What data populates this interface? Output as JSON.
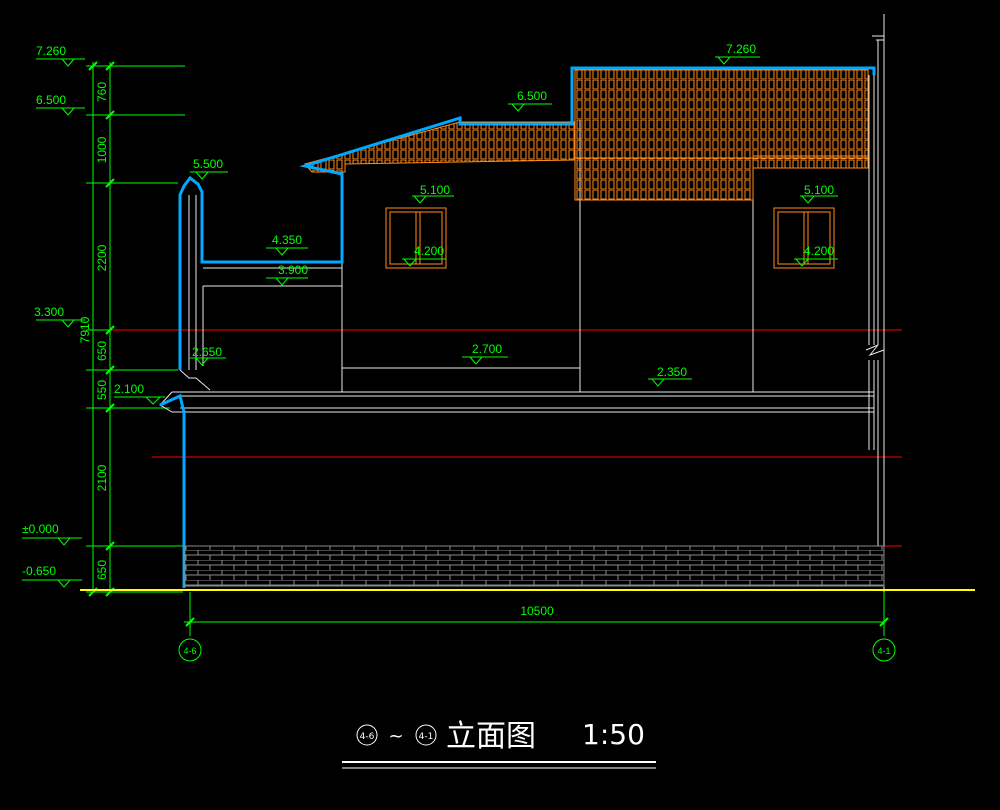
{
  "drawing": {
    "levels": [
      {
        "id": "left-7260",
        "text": "7.260"
      },
      {
        "id": "left-6500",
        "text": "6.500"
      },
      {
        "id": "left-3300",
        "text": "3.300"
      },
      {
        "id": "left-2100",
        "text": "2.100"
      },
      {
        "id": "left-0000",
        "text": "±0.000"
      },
      {
        "id": "left-m0650",
        "text": "-0.650"
      },
      {
        "id": "parapet-5500",
        "text": "5.500"
      },
      {
        "id": "low-roof-4350",
        "text": "4.350"
      },
      {
        "id": "low-roof-3900",
        "text": "3.900"
      },
      {
        "id": "canopy-2650",
        "text": "2.650"
      },
      {
        "id": "eave-6500",
        "text": "6.500"
      },
      {
        "id": "ridge-7260",
        "text": "7.260"
      },
      {
        "id": "win1-5100",
        "text": "5.100"
      },
      {
        "id": "win1-4200",
        "text": "4.200"
      },
      {
        "id": "win2-5100",
        "text": "5.100"
      },
      {
        "id": "win2-4200",
        "text": "4.200"
      },
      {
        "id": "floor-2700",
        "text": "2.700"
      },
      {
        "id": "floor-2350",
        "text": "2.350"
      }
    ],
    "vertical_dims": [
      "760",
      "1000",
      "2200",
      "650",
      "550",
      "2100",
      "650"
    ],
    "total_height": "7910",
    "horizontal_dim": "10500",
    "axes": {
      "left": "4-6",
      "right": "4-1"
    },
    "title": {
      "axis_from": "4-6",
      "tilde": "~",
      "axis_to": "4-1",
      "name": "立面图",
      "scale": "1:50"
    },
    "colors": {
      "dimension": "#00ff00",
      "outline": "#00a8ff",
      "roof_tiles": "#ff8c1a",
      "wall_lines": "#ffffff",
      "level_lines": "#ff0000",
      "ground_line": "#ffff00",
      "base_brick": "#7a7a7a"
    }
  }
}
